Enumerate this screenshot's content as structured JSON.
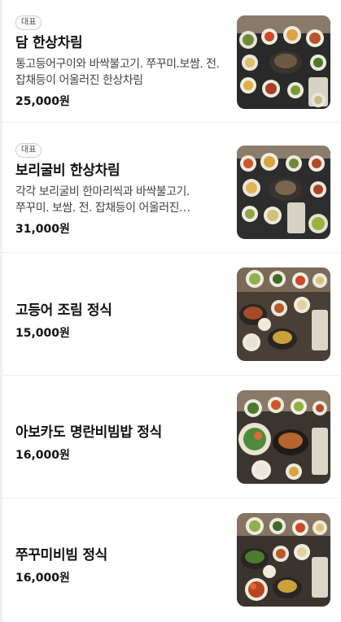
{
  "menu": {
    "items": [
      {
        "badge": "대표",
        "name": "담 한상차림",
        "description": "통고등어구이와 바싹불고기. 쭈꾸미.보쌈. 전. 잡채등이 어울러진 한상차림",
        "price": "25,000원",
        "image": "korean-table-set-photo"
      },
      {
        "badge": "대표",
        "name": "보리굴비 한상차림",
        "description": "각각 보리굴비 한마리씩과 바싹불고기. 쭈꾸미. 보쌈. 전. 잡채등이 어울러진…",
        "price": "31,000원",
        "image": "korean-table-set-photo"
      },
      {
        "name": "고등어 조림 정식",
        "price": "15,000원",
        "image": "korean-table-set-photo"
      },
      {
        "name": "아보카도 명란비빔밥 정식",
        "price": "16,000원",
        "image": "korean-table-set-photo"
      },
      {
        "name": "쭈꾸미비빔 정식",
        "price": "16,000원",
        "image": "korean-table-set-photo"
      }
    ]
  }
}
